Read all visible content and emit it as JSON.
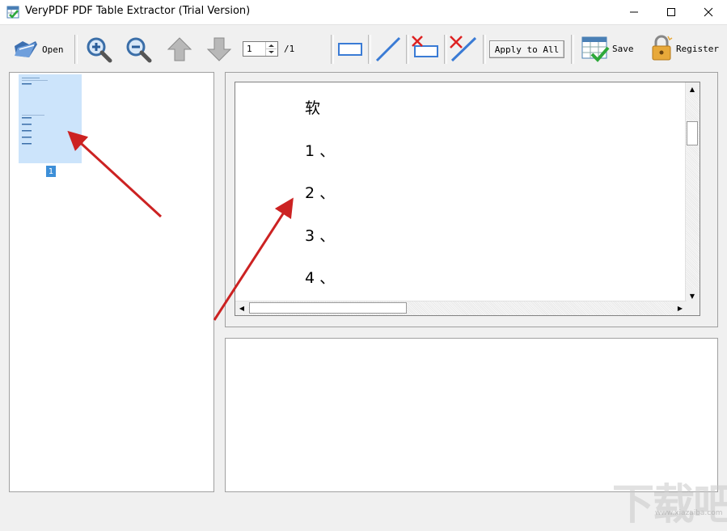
{
  "window": {
    "title": "VeryPDF PDF Table Extractor (Trial Version)"
  },
  "toolbar": {
    "open_label": "Open",
    "page_current": "1",
    "page_total": "/1",
    "apply_label": "Apply to All",
    "save_label": "Save",
    "register_label": "Register"
  },
  "thumbnails": {
    "items": [
      {
        "number": "1"
      }
    ]
  },
  "document": {
    "lines": [
      "软",
      "1 、",
      "2 、",
      "3 、",
      "4 、"
    ]
  },
  "watermark": {
    "text": "下载吧",
    "url": "www.xiazaiba.com"
  },
  "colors": {
    "accent": "#3d8fd8",
    "thumbnail_selected": "#cce4fb",
    "arrow": "#cc2222"
  }
}
